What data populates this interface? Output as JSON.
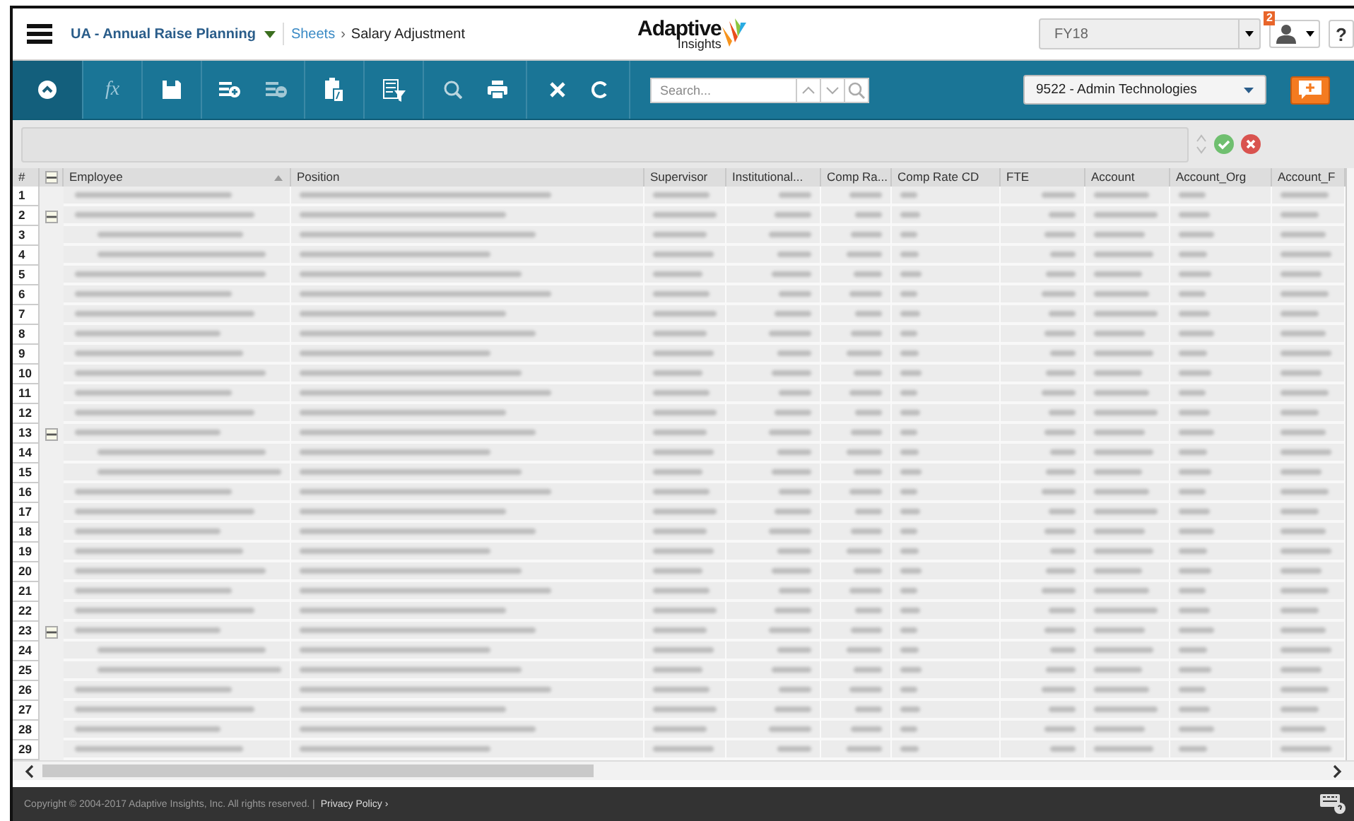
{
  "header": {
    "workspace": "UA - Annual Raise Planning",
    "breadcrumb_link": "Sheets",
    "breadcrumb_separator": "›",
    "page_title": "Salary Adjustment",
    "logo_word": "Adaptive",
    "logo_sub": "Insights",
    "period": "FY18",
    "notification_count": "2",
    "help": "?"
  },
  "toolbar": {
    "formula_label": "fx",
    "search": {
      "placeholder": "Search..."
    },
    "level": "9522 - Admin Technologies"
  },
  "table": {
    "columns": [
      "#",
      "Employee",
      "Position",
      "Supervisor",
      "Institutional...",
      "Comp Ra...",
      "Comp Rate CD",
      "FTE",
      "Account",
      "Account_Org",
      "Account_F"
    ],
    "rows": [
      {
        "number": "1"
      },
      {
        "number": "2",
        "expanded": true,
        "children": [
          {
            "number": "3"
          },
          {
            "number": "4"
          }
        ]
      },
      {
        "number": "5"
      },
      {
        "number": "6"
      },
      {
        "number": "7"
      },
      {
        "number": "8"
      },
      {
        "number": "9"
      },
      {
        "number": "10"
      },
      {
        "number": "11"
      },
      {
        "number": "12"
      },
      {
        "number": "13",
        "expanded": true,
        "children": [
          {
            "number": "14"
          },
          {
            "number": "15"
          }
        ]
      },
      {
        "number": "16"
      },
      {
        "number": "17"
      },
      {
        "number": "18"
      },
      {
        "number": "19"
      },
      {
        "number": "20"
      },
      {
        "number": "21"
      },
      {
        "number": "22"
      },
      {
        "number": "23",
        "expanded": true,
        "children": [
          {
            "number": "24"
          },
          {
            "number": "25"
          }
        ]
      },
      {
        "number": "26"
      },
      {
        "number": "27"
      },
      {
        "number": "28"
      },
      {
        "number": "29"
      }
    ]
  },
  "footer": {
    "copyright": "Copyright © 2004-2017 Adaptive Insights, Inc. All rights reserved. |",
    "privacy_link": "Privacy Policy ›"
  }
}
